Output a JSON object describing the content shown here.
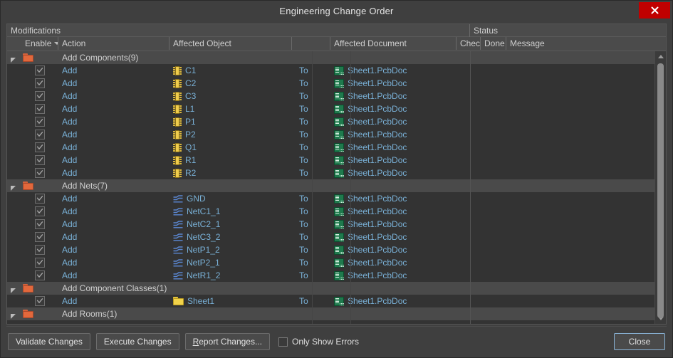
{
  "window": {
    "title": "Engineering Change Order",
    "close_icon": "close-x-icon"
  },
  "table": {
    "group_headers": [
      {
        "label": "Modifications"
      },
      {
        "label": "Status"
      }
    ],
    "columns": [
      {
        "key": "spacer",
        "label": ""
      },
      {
        "key": "enable",
        "label": "Enable",
        "sorted": true
      },
      {
        "key": "action",
        "label": "Action"
      },
      {
        "key": "object",
        "label": "Affected Object"
      },
      {
        "key": "to",
        "label": ""
      },
      {
        "key": "document",
        "label": "Affected Document"
      },
      {
        "key": "check",
        "label": "Check"
      },
      {
        "key": "done",
        "label": "Done"
      },
      {
        "key": "message",
        "label": "Message"
      }
    ],
    "rows": [
      {
        "type": "group",
        "label": "Add Components(9)",
        "icon": "folder-icon"
      },
      {
        "type": "item",
        "enabled": true,
        "action": "Add",
        "object": "C1",
        "object_icon": "component-icon",
        "to": "To",
        "document": "Sheet1.PcbDoc",
        "document_icon": "pcbdoc-icon",
        "check": "",
        "done": "",
        "message": ""
      },
      {
        "type": "item",
        "enabled": true,
        "action": "Add",
        "object": "C2",
        "object_icon": "component-icon",
        "to": "To",
        "document": "Sheet1.PcbDoc",
        "document_icon": "pcbdoc-icon",
        "check": "",
        "done": "",
        "message": ""
      },
      {
        "type": "item",
        "enabled": true,
        "action": "Add",
        "object": "C3",
        "object_icon": "component-icon",
        "to": "To",
        "document": "Sheet1.PcbDoc",
        "document_icon": "pcbdoc-icon",
        "check": "",
        "done": "",
        "message": ""
      },
      {
        "type": "item",
        "enabled": true,
        "action": "Add",
        "object": "L1",
        "object_icon": "component-icon",
        "to": "To",
        "document": "Sheet1.PcbDoc",
        "document_icon": "pcbdoc-icon",
        "check": "",
        "done": "",
        "message": ""
      },
      {
        "type": "item",
        "enabled": true,
        "action": "Add",
        "object": "P1",
        "object_icon": "component-icon",
        "to": "To",
        "document": "Sheet1.PcbDoc",
        "document_icon": "pcbdoc-icon",
        "check": "",
        "done": "",
        "message": ""
      },
      {
        "type": "item",
        "enabled": true,
        "action": "Add",
        "object": "P2",
        "object_icon": "component-icon",
        "to": "To",
        "document": "Sheet1.PcbDoc",
        "document_icon": "pcbdoc-icon",
        "check": "",
        "done": "",
        "message": ""
      },
      {
        "type": "item",
        "enabled": true,
        "action": "Add",
        "object": "Q1",
        "object_icon": "component-icon",
        "to": "To",
        "document": "Sheet1.PcbDoc",
        "document_icon": "pcbdoc-icon",
        "check": "",
        "done": "",
        "message": ""
      },
      {
        "type": "item",
        "enabled": true,
        "action": "Add",
        "object": "R1",
        "object_icon": "component-icon",
        "to": "To",
        "document": "Sheet1.PcbDoc",
        "document_icon": "pcbdoc-icon",
        "check": "",
        "done": "",
        "message": ""
      },
      {
        "type": "item",
        "enabled": true,
        "action": "Add",
        "object": "R2",
        "object_icon": "component-icon",
        "to": "To",
        "document": "Sheet1.PcbDoc",
        "document_icon": "pcbdoc-icon",
        "check": "",
        "done": "",
        "message": ""
      },
      {
        "type": "group",
        "label": "Add Nets(7)",
        "icon": "folder-icon"
      },
      {
        "type": "item",
        "enabled": true,
        "action": "Add",
        "object": "GND",
        "object_icon": "net-icon",
        "to": "To",
        "document": "Sheet1.PcbDoc",
        "document_icon": "pcbdoc-icon",
        "check": "",
        "done": "",
        "message": ""
      },
      {
        "type": "item",
        "enabled": true,
        "action": "Add",
        "object": "NetC1_1",
        "object_icon": "net-icon",
        "to": "To",
        "document": "Sheet1.PcbDoc",
        "document_icon": "pcbdoc-icon",
        "check": "",
        "done": "",
        "message": ""
      },
      {
        "type": "item",
        "enabled": true,
        "action": "Add",
        "object": "NetC2_1",
        "object_icon": "net-icon",
        "to": "To",
        "document": "Sheet1.PcbDoc",
        "document_icon": "pcbdoc-icon",
        "check": "",
        "done": "",
        "message": ""
      },
      {
        "type": "item",
        "enabled": true,
        "action": "Add",
        "object": "NetC3_2",
        "object_icon": "net-icon",
        "to": "To",
        "document": "Sheet1.PcbDoc",
        "document_icon": "pcbdoc-icon",
        "check": "",
        "done": "",
        "message": ""
      },
      {
        "type": "item",
        "enabled": true,
        "action": "Add",
        "object": "NetP1_2",
        "object_icon": "net-icon",
        "to": "To",
        "document": "Sheet1.PcbDoc",
        "document_icon": "pcbdoc-icon",
        "check": "",
        "done": "",
        "message": ""
      },
      {
        "type": "item",
        "enabled": true,
        "action": "Add",
        "object": "NetP2_1",
        "object_icon": "net-icon",
        "to": "To",
        "document": "Sheet1.PcbDoc",
        "document_icon": "pcbdoc-icon",
        "check": "",
        "done": "",
        "message": ""
      },
      {
        "type": "item",
        "enabled": true,
        "action": "Add",
        "object": "NetR1_2",
        "object_icon": "net-icon",
        "to": "To",
        "document": "Sheet1.PcbDoc",
        "document_icon": "pcbdoc-icon",
        "check": "",
        "done": "",
        "message": ""
      },
      {
        "type": "group",
        "label": "Add Component Classes(1)",
        "icon": "folder-icon"
      },
      {
        "type": "item",
        "enabled": true,
        "action": "Add",
        "object": "Sheet1",
        "object_icon": "yellow-folder-icon",
        "to": "To",
        "document": "Sheet1.PcbDoc",
        "document_icon": "pcbdoc-icon",
        "check": "",
        "done": "",
        "message": ""
      },
      {
        "type": "group",
        "label": "Add Rooms(1)",
        "icon": "folder-icon"
      }
    ],
    "scrollbar": {
      "up_icon": "chevron-up-icon",
      "down_icon": "chevron-down-icon"
    }
  },
  "footer": {
    "validate_label": "Validate Changes",
    "execute_label": "Execute Changes",
    "report_label_accel": "R",
    "report_label_rest": "eport Changes...",
    "only_show_errors_label": "Only Show Errors",
    "only_show_errors_checked": false,
    "close_label": "Close"
  },
  "colors": {
    "window_bg": "#3f3f3f",
    "panel_bg": "#333333",
    "header_bg": "#4b4b4b",
    "group_row_bg": "#4a4a4a",
    "link_text": "#79b0d6",
    "close_button": "#c00000",
    "folder_orange": "#e2683c",
    "folder_yellow": "#f2d34a",
    "net_blue": "#4a78c8",
    "pcb_green": "#1f7a4d",
    "default_button_border": "#8ab4d8"
  }
}
